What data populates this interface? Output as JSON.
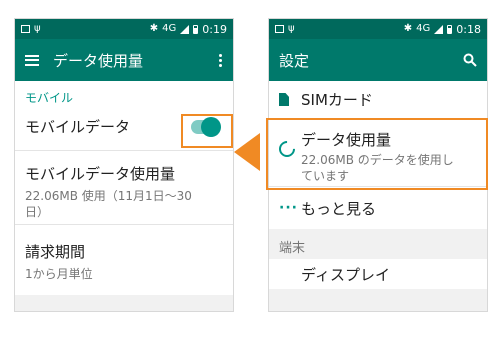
{
  "left_phone": {
    "status": {
      "time": "0:19",
      "network": "4G"
    },
    "appbar": {
      "title": "データ使用量"
    },
    "section_label": "モバイル",
    "mobile_data": {
      "label": "モバイルデータ",
      "enabled": true
    },
    "usage": {
      "label": "モバイルデータ使用量",
      "detail_line1": "22.06MB 使用（11月1日〜30",
      "detail_line2": "日）"
    },
    "billing": {
      "label": "請求期間",
      "detail": "1から月単位"
    }
  },
  "right_phone": {
    "status": {
      "time": "0:18",
      "network": "4G"
    },
    "appbar": {
      "title": "設定"
    },
    "items": {
      "sim": {
        "label": "SIMカード",
        "icon": "sim-card-icon"
      },
      "data_usage": {
        "label": "データ使用量",
        "detail_line1": "22.06MB のデータを使用し",
        "detail_line2": "ています",
        "icon": "data-usage-icon"
      },
      "more": {
        "label": "もっと見る",
        "icon": "more-icon"
      }
    },
    "category": "端末",
    "display": {
      "label": "ディスプレイ"
    }
  },
  "colors": {
    "statusbar": "#00695c",
    "appbar": "#00796b",
    "accent": "#009688",
    "highlight": "#f08a24"
  }
}
